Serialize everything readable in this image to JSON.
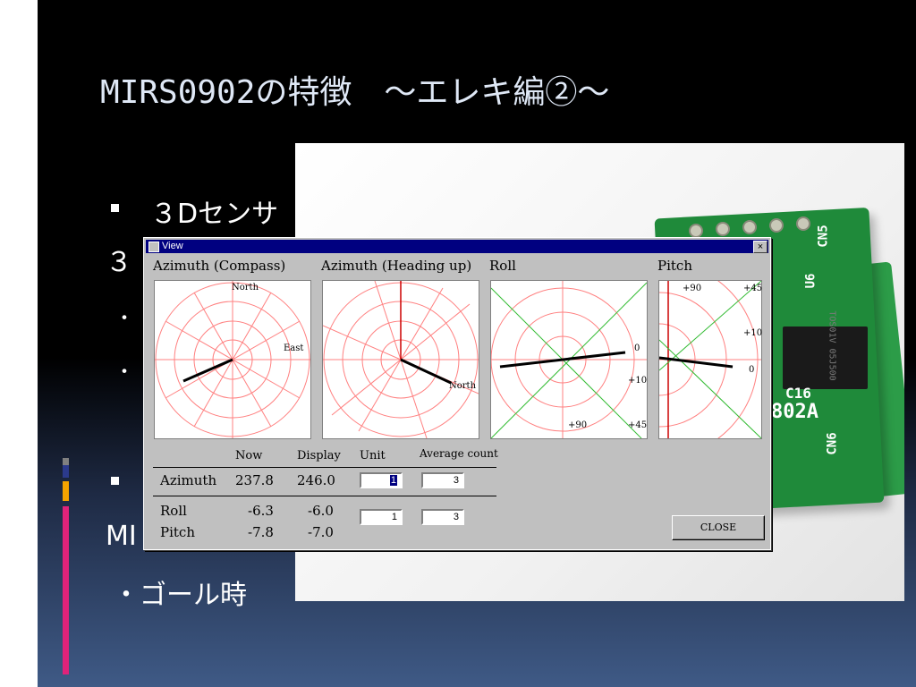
{
  "slide": {
    "title": "MIRS0902の特徴　～エレキ編②～",
    "bullet1": "３Dセンサ",
    "line2": "３",
    "bullet_dot": "・",
    "line_mi": "MI",
    "bottom_line": "・ゴール時"
  },
  "pcb": {
    "label_cn5": "CN5",
    "label_cn6": "CN6",
    "label_u6": "U6",
    "label_c16": "C16",
    "label_board": "802A",
    "chip_text": "TOS01V 05J500"
  },
  "dialog": {
    "title": "View",
    "close_x": "×",
    "panels": [
      {
        "title": "Azimuth (Compass)",
        "labels": {
          "north": "North",
          "east": "East"
        }
      },
      {
        "title": "Azimuth (Heading up)",
        "labels": {
          "north": "North"
        }
      },
      {
        "title": "Roll",
        "labels": {
          "zero": "0",
          "plus10": "+10",
          "plus90": "+90",
          "plus45": "+45"
        }
      },
      {
        "title": "Pitch",
        "labels": {
          "plus90": "+90",
          "plus45": "+45",
          "plus10": "+10",
          "zero": "0"
        }
      }
    ],
    "table": {
      "headers": {
        "now": "Now",
        "display": "Display",
        "unit": "Unit",
        "avg": "Average count"
      },
      "azimuth": {
        "label": "Azimuth",
        "now": "237.8",
        "display": "246.0",
        "unit": "1",
        "avg": "3"
      },
      "roll": {
        "label": "Roll",
        "now": "-6.3",
        "display": "-6.0"
      },
      "pitch": {
        "label": "Pitch",
        "now": "-7.8",
        "display": "-7.0"
      },
      "roll_pitch_unit": "1",
      "roll_pitch_avg": "3"
    },
    "close_label": "CLOSE"
  },
  "colors": {
    "title_bar": "#000080",
    "grid_red": "#ff8080",
    "grid_green": "#33bb33",
    "needle": "#000000",
    "strip_pink": "#e0237a",
    "strip_orange": "#f5a300",
    "strip_blue": "#2b3a8c"
  }
}
